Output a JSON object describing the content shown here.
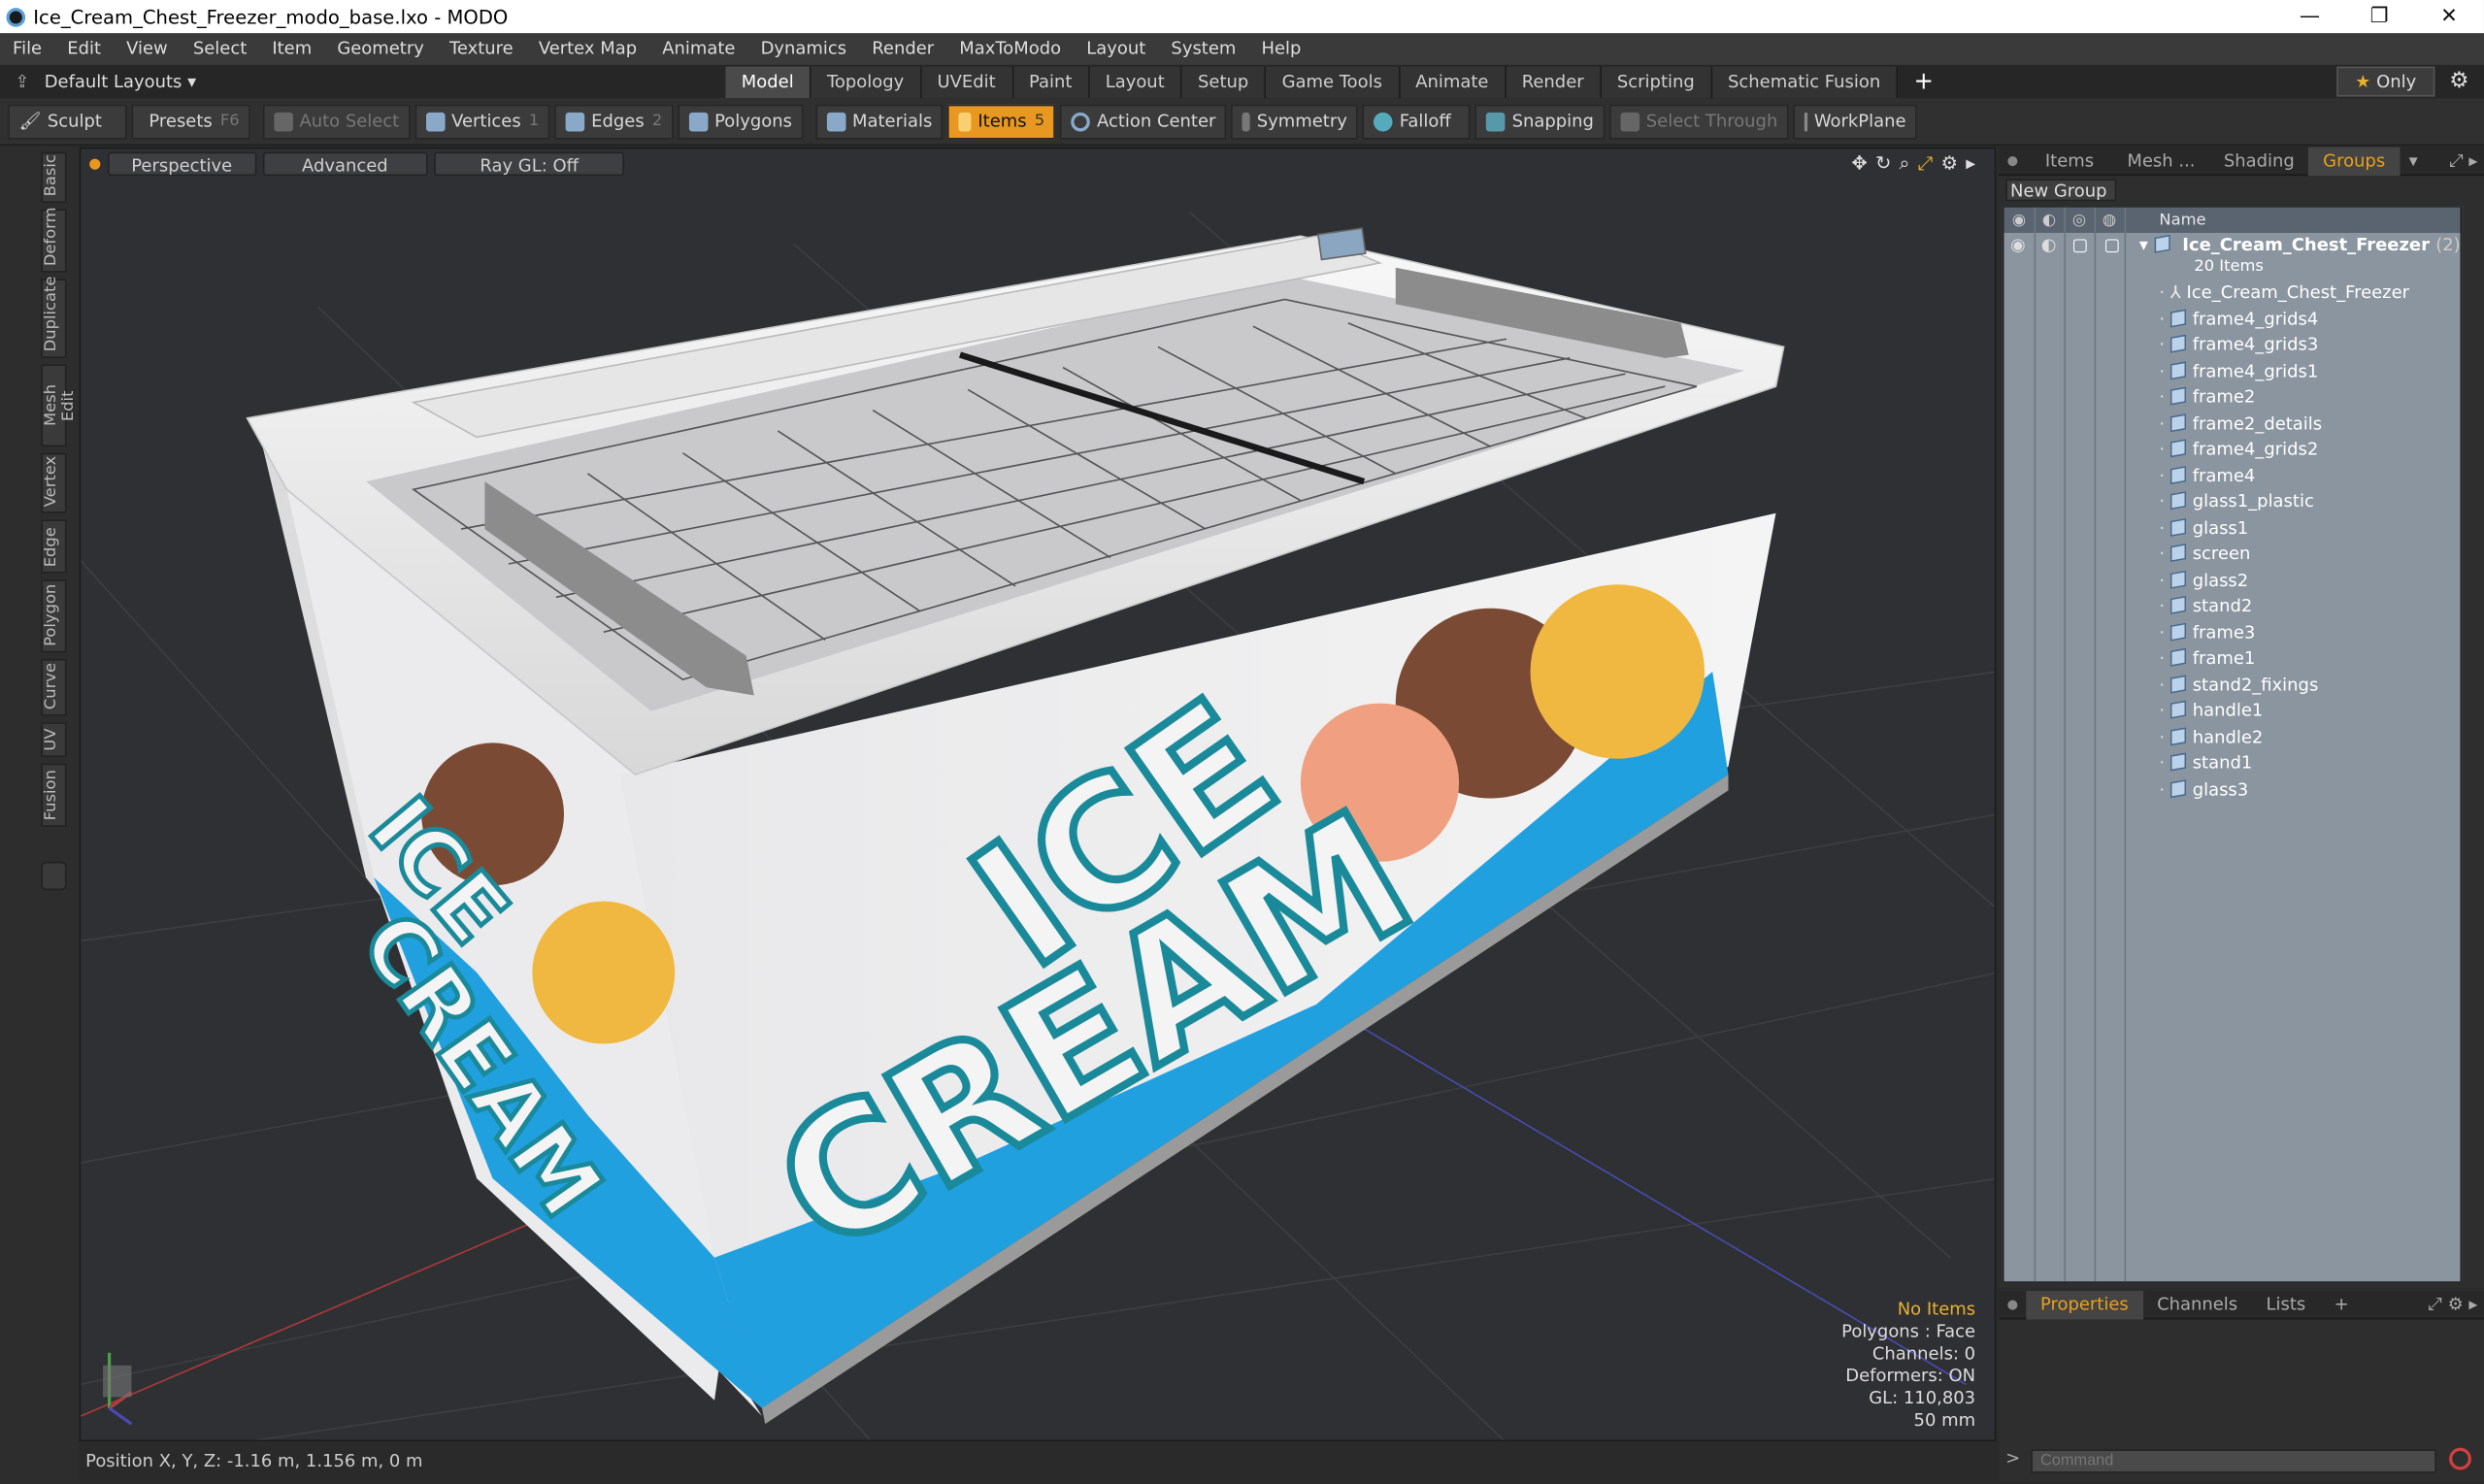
{
  "window": {
    "title": "Ice_Cream_Chest_Freezer_modo_base.lxo - MODO",
    "minimize": "—",
    "maximize": "❐",
    "close": "✕"
  },
  "menu": [
    "File",
    "Edit",
    "View",
    "Select",
    "Item",
    "Geometry",
    "Texture",
    "Vertex Map",
    "Animate",
    "Dynamics",
    "Render",
    "MaxToModo",
    "Layout",
    "System",
    "Help"
  ],
  "layoutbar": {
    "default_layouts": "Default Layouts ▾",
    "tabs": [
      "Model",
      "Topology",
      "UVEdit",
      "Paint",
      "Layout",
      "Setup",
      "Game Tools",
      "Animate",
      "Render",
      "Scripting",
      "Schematic Fusion"
    ],
    "active_tab": "Model",
    "add": "+",
    "only": "Only"
  },
  "toolbar": {
    "sculpt": "Sculpt",
    "presets": "Presets",
    "presets_key": "F6",
    "auto_select": "Auto Select",
    "vertices": "Vertices",
    "vertices_count": "1",
    "edges": "Edges",
    "edges_count": "2",
    "polygons": "Polygons",
    "materials": "Materials",
    "items": "Items",
    "items_count": "5",
    "action_center": "Action Center",
    "symmetry": "Symmetry",
    "falloff": "Falloff",
    "snapping": "Snapping",
    "select_through": "Select Through",
    "workplane": "WorkPlane"
  },
  "left_tabs": [
    "Basic",
    "Deform",
    "Duplicate",
    "Mesh Edit",
    "Vertex",
    "Edge",
    "Polygon",
    "Curve",
    "UV",
    "Fusion"
  ],
  "viewport": {
    "perspective": "Perspective",
    "advanced": "Advanced",
    "raygl": "Ray GL: Off",
    "decal_line1": "ICE",
    "decal_line2": "CREAM",
    "info": {
      "no_items": "No Items",
      "polygons": "Polygons : Face",
      "channels": "Channels: 0",
      "deformers": "Deformers: ON",
      "gl": "GL: 110,803",
      "scale": "50 mm"
    }
  },
  "status": {
    "position": "Position X, Y, Z:   -1.16 m, 1.156 m, 0 m"
  },
  "right_panel": {
    "tabs": [
      "Items",
      "Mesh ...",
      "Shading",
      "Groups"
    ],
    "active_tab": "Groups",
    "new_group": "New Group",
    "name_header": "Name",
    "group_name": "Ice_Cream_Chest_Freezer",
    "group_count": "(2)",
    "group_items": "20 Items",
    "locator": "Ice_Cream_Chest_Freezer",
    "items": [
      "frame4_grids4",
      "frame4_grids3",
      "frame4_grids1",
      "frame2",
      "frame2_details",
      "frame4_grids2",
      "frame4",
      "glass1_plastic",
      "glass1",
      "screen",
      "glass2",
      "stand2",
      "frame3",
      "frame1",
      "stand2_fixings",
      "handle1",
      "handle2",
      "stand1",
      "glass3"
    ]
  },
  "bottom_panel": {
    "tabs": [
      "Properties",
      "Channels",
      "Lists"
    ],
    "add": "+",
    "command_placeholder": "Command",
    "prompt": ">"
  }
}
